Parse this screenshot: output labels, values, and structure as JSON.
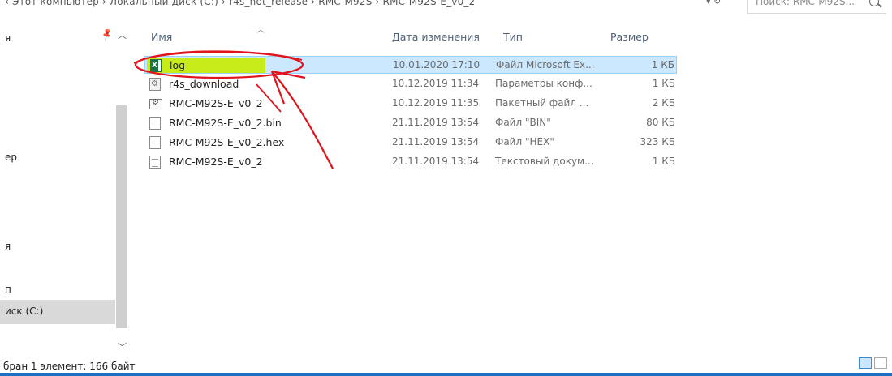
{
  "address_bar": {
    "breadcrumb": "‹ Этот компьютер › Локальный диск (C:) › r4s_not_release › RMC-M92S › RMC-M92S-E_v0_2",
    "search_placeholder": "Поиск: RMC-M92S..."
  },
  "nav_pane": {
    "items": [
      {
        "label": "я"
      },
      {
        "label": "ер"
      },
      {
        "label": "я"
      },
      {
        "label": "п"
      },
      {
        "label": "иск (C:)",
        "selected": true
      }
    ]
  },
  "columns": {
    "name": "Имя",
    "date": "Дата изменения",
    "type": "Тип",
    "size": "Размер"
  },
  "files": [
    {
      "name": "log",
      "date": "10.01.2020 17:10",
      "type": "Файл Microsoft Ex...",
      "size": "1 КБ",
      "icon": "excel-file-icon",
      "selected": true
    },
    {
      "name": "r4s_download",
      "date": "10.12.2019 11:34",
      "type": "Параметры конф...",
      "size": "1 КБ",
      "icon": "config-file-icon"
    },
    {
      "name": "RMC-M92S-E_v0_2",
      "date": "10.12.2019 11:35",
      "type": "Пакетный файл ...",
      "size": "2 КБ",
      "icon": "batch-file-icon"
    },
    {
      "name": "RMC-M92S-E_v0_2.bin",
      "date": "21.11.2019 13:54",
      "type": "Файл \"BIN\"",
      "size": "80 КБ",
      "icon": "generic-file-icon"
    },
    {
      "name": "RMC-M92S-E_v0_2.hex",
      "date": "21.11.2019 13:54",
      "type": "Файл \"HEX\"",
      "size": "323 КБ",
      "icon": "generic-file-icon"
    },
    {
      "name": "RMC-M92S-E_v0_2",
      "date": "21.11.2019 13:54",
      "type": "Текстовый докум...",
      "size": "1 КБ",
      "icon": "text-file-icon"
    }
  ],
  "status_bar": {
    "text": "бран 1 элемент: 166 байт"
  },
  "colors": {
    "selection_bg": "#cce8ff",
    "highlighter": "#c8ec00",
    "annotation": "#e0141b",
    "accent": "#1e6fc2"
  }
}
